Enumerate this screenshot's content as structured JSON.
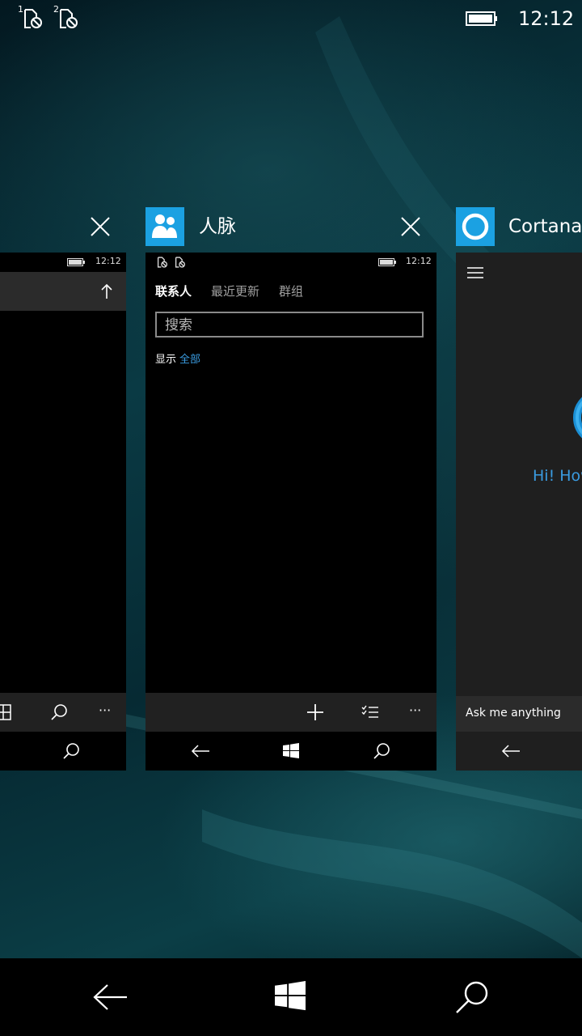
{
  "status_bar": {
    "sim1_label": "1",
    "sim2_label": "2",
    "time": "12:12",
    "icons": [
      "sim-no-service-icon",
      "sim-no-service-icon",
      "battery-full-icon"
    ]
  },
  "cards": {
    "left": {
      "mini_time": "12:12",
      "icons": [
        "close-icon",
        "arrow-up-icon",
        "grid-icon",
        "search-icon",
        "more-icon",
        "search-icon"
      ],
      "more_label": "···"
    },
    "people": {
      "title": "人脉",
      "mini_time": "12:12",
      "tabs": [
        "联系人",
        "最近更新",
        "群组"
      ],
      "search_placeholder": "搜索",
      "show_prefix": "显示",
      "show_value": "全部",
      "more_label": "···",
      "icons": [
        "people-app-icon",
        "close-icon",
        "add-icon",
        "select-list-icon",
        "more-icon",
        "back-arrow-icon",
        "windows-icon",
        "search-icon"
      ]
    },
    "cortana": {
      "title": "Cortana",
      "greeting": "Hi! How",
      "ask": "Ask me anything",
      "icons": [
        "cortana-circle-icon",
        "hamburger-menu-icon",
        "back-arrow-icon"
      ]
    }
  },
  "system_nav": {
    "icons": [
      "back-arrow-icon",
      "windows-icon",
      "search-icon"
    ]
  },
  "colors": {
    "accent": "#1ba1e2",
    "link_blue": "#3a9be0",
    "app_bar": "#212121",
    "card_bg": "#000000"
  }
}
